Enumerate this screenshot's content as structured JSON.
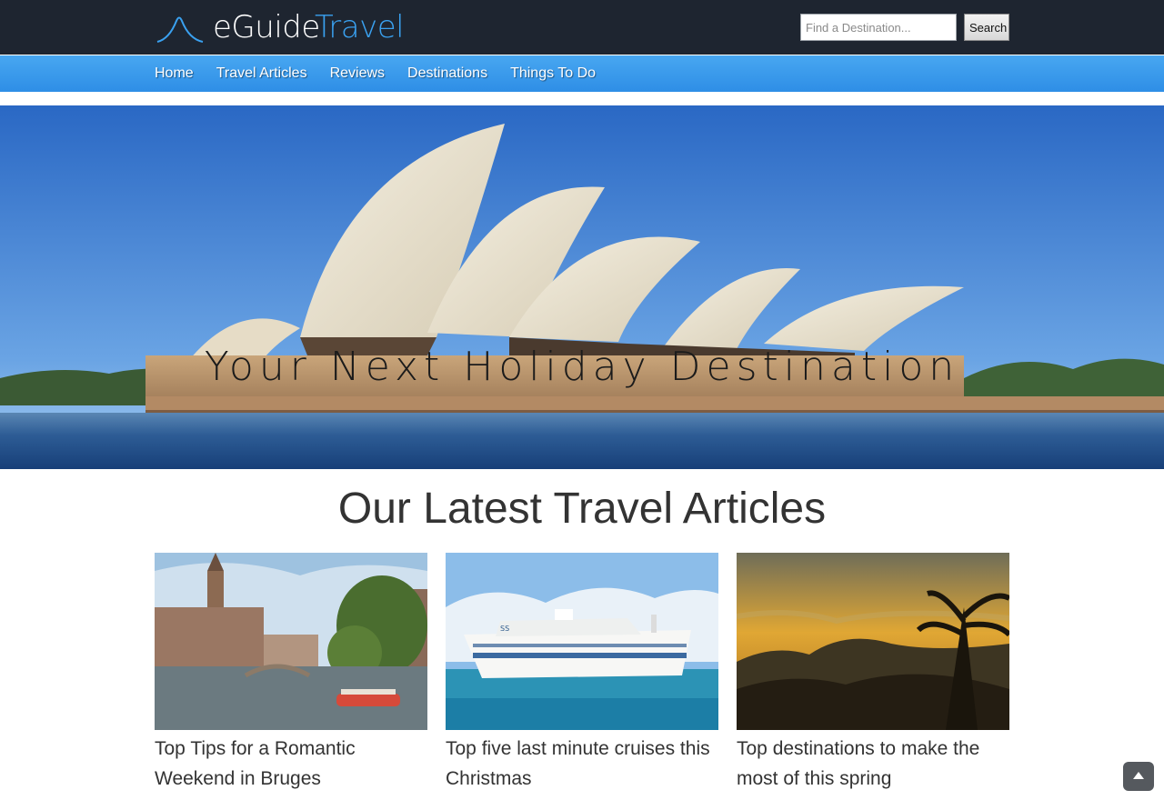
{
  "header": {
    "logo_word1": "eGuide",
    "logo_word2": "Travel",
    "search_placeholder": "Find a Destination...",
    "search_button": "Search"
  },
  "nav": {
    "items": [
      "Home",
      "Travel Articles",
      "Reviews",
      "Destinations",
      "Things To Do"
    ]
  },
  "hero": {
    "title": "Your Next Holiday Destination"
  },
  "articles": {
    "heading": "Our Latest Travel Articles",
    "items": [
      {
        "title": "Top Tips for a Romantic Weekend in Bruges"
      },
      {
        "title": "Top five last minute cruises this Christmas"
      },
      {
        "title": "Top destinations to make the most of this spring"
      }
    ]
  },
  "icons": {
    "logo": "mountain-arc-icon",
    "back_to_top": "chevron-up-icon"
  },
  "colors": {
    "header_bg": "#1e2530",
    "nav_bg": "#3a9aec",
    "logo_accent": "#3aa1f0",
    "heading_text": "#333333"
  }
}
